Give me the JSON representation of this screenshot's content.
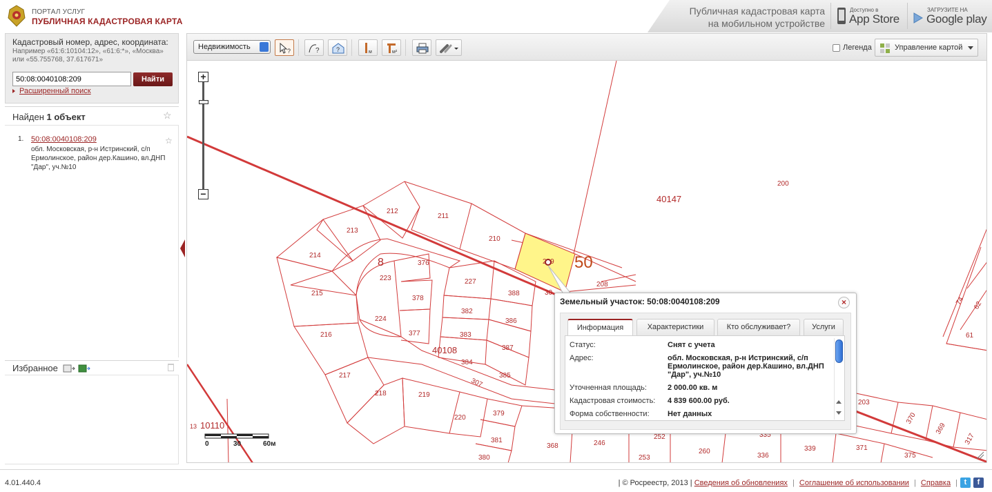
{
  "header": {
    "brand_sub": "ПОРТАЛ УСЛУГ",
    "brand_main": "ПУБЛИЧНАЯ КАДАСТРОВАЯ КАРТА",
    "mobile_line1": "Публичная кадастровая карта",
    "mobile_line2": "на мобильном устройстве",
    "appstore_small": "Доступно в",
    "appstore_big": "App Store",
    "googleplay_small": "ЗАГРУЗИТЕ НА",
    "googleplay_big": "Google play"
  },
  "search": {
    "title": "Кадастровый номер, адрес, координата:",
    "hint": "Например «61:6:10104:12», «61:6:*», «Москва» или «55.755768, 37.617671»",
    "value": "50:08:0040108:209",
    "button": "Найти",
    "advanced_link": "Расширенный поиск"
  },
  "results": {
    "found_prefix": "Найден ",
    "found_count": "1 объект",
    "items": [
      {
        "num": "1.",
        "link": "50:08:0040108:209",
        "address": "обл. Московская, р-н Истринский, с/п Ермолинское, район дер.Кашино, вл.ДНП \"Дар\", уч.№10"
      }
    ]
  },
  "favorites": {
    "title": "Избранное"
  },
  "toolbar": {
    "layer_select": "Недвижимость",
    "legend_label": "Легенда",
    "map_manage": "Управление картой"
  },
  "map": {
    "scale_labels": [
      "0",
      "30",
      "60м"
    ],
    "parcel_labels": {
      "p40147": "40147",
      "p200": "200",
      "p212": "212",
      "p211": "211",
      "p210": "210",
      "p213": "213",
      "p214": "214",
      "p8": "8",
      "p376": "376",
      "p223": "223",
      "p209": "209",
      "p50": "50",
      "p208": "208",
      "p227": "227",
      "p388": "388",
      "p215": "215",
      "p378": "378",
      "p382": "382",
      "p386": "386",
      "p224": "224",
      "p383": "383",
      "p377": "377",
      "p216": "216",
      "p387": "387",
      "p40108": "40108",
      "p384": "384",
      "p385": "385",
      "p217": "217",
      "p307": "307",
      "p218": "218",
      "p219": "219",
      "p220": "220",
      "p379": "379",
      "p381": "381",
      "p380": "380",
      "p368": "368",
      "p246": "246",
      "p252": "252",
      "p253": "253",
      "p260": "260",
      "p335": "335",
      "p336": "336",
      "p339": "339",
      "p371": "371",
      "p375": "375",
      "p203": "203",
      "p370": "370",
      "p369": "369",
      "p317": "317",
      "p61": "61",
      "p62": "62",
      "p74": "74",
      "p10110": "10110",
      "p13": "13",
      "p30x": "30"
    }
  },
  "popup": {
    "title": "Земельный участок: 50:08:0040108:209",
    "close": "×",
    "tabs": [
      "Информация",
      "Характеристики",
      "Кто обслуживает?",
      "Услуги"
    ],
    "rows": [
      {
        "key": "Статус:",
        "value": "Снят с учета"
      },
      {
        "key": "Адрес:",
        "value": "обл. Московская, р-н Истринский, с/п Ермолинское, район дер.Кашино, вл.ДНП \"Дар\", уч.№10"
      },
      {
        "key": "Уточненная площадь:",
        "value": "2 000.00 кв. м"
      },
      {
        "key": "Кадастровая стоимость:",
        "value": "4 839 600.00 руб."
      },
      {
        "key": "Форма собственности:",
        "value": "Нет данных"
      }
    ]
  },
  "footer": {
    "version": "4.01.440.4",
    "copyright": "| © Росреестр, 2013 |",
    "link_updates": "Сведения об обновлениях",
    "link_agreement": "Соглашение об использовании",
    "link_help": "Справка",
    "sep": "|"
  },
  "colors": {
    "accent": "#9b2424",
    "parcel_line": "#d23a3a",
    "selected_fill": "#fff58a"
  }
}
